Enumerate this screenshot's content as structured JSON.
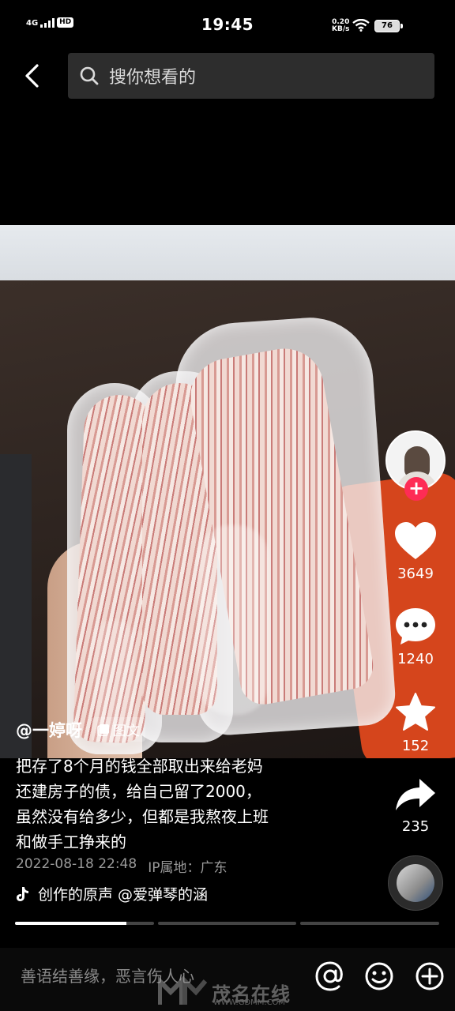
{
  "status_bar": {
    "network": "4G",
    "hd": "HD",
    "time": "19:45",
    "speed_value": "0.20",
    "speed_unit": "KB/s",
    "battery": "76"
  },
  "search": {
    "placeholder": "搜你想看的"
  },
  "post": {
    "author": "@一婷呀",
    "type_tag": "图文",
    "description_lines": [
      "把存了8个月的钱全部取出来给老妈",
      "还建房子的债，给自己留了2000，",
      "虽然没有给多少，但都是我熬夜上班",
      "和做手工挣来的"
    ],
    "date": "2022-08-18 22:48",
    "ip_location": "IP属地：广东",
    "music_text": "创作的原声    @爱弹琴的涵"
  },
  "actions": {
    "likes": "3649",
    "comments": "1240",
    "favorites": "152",
    "shares": "235"
  },
  "progress": {
    "segments": 3,
    "active_index": 0,
    "active_fill": 0.8
  },
  "comment_bar": {
    "placeholder": "善语结善缘，恶言伤人心"
  },
  "watermark": {
    "text": "茂名在线",
    "url": "WWW.GDMM.COM"
  },
  "colors": {
    "accent": "#fe2c55",
    "background": "#000000"
  }
}
